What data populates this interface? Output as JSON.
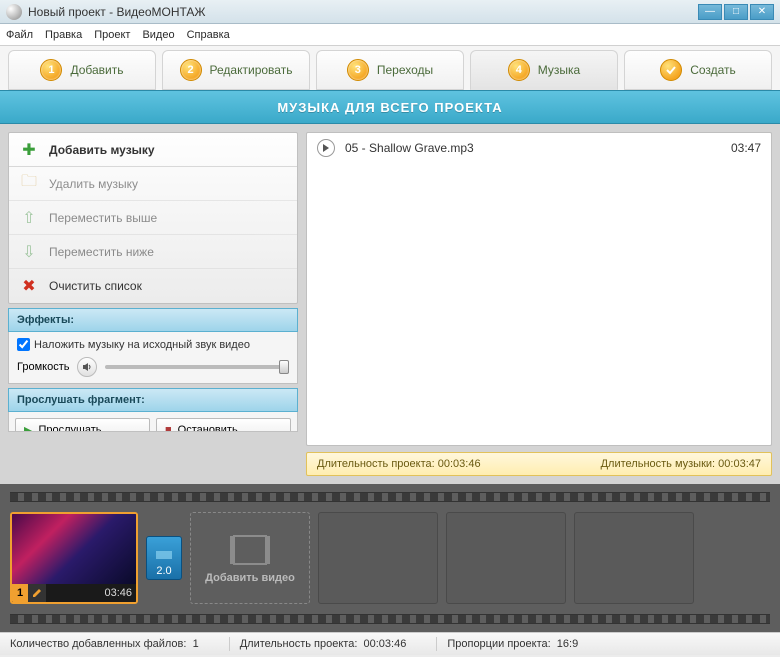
{
  "window": {
    "title": "Новый проект - ВидеоМОНТАЖ"
  },
  "menu": {
    "file": "Файл",
    "edit": "Правка",
    "project": "Проект",
    "video": "Видео",
    "help": "Справка"
  },
  "tabs": {
    "t1": {
      "num": "1",
      "label": "Добавить"
    },
    "t2": {
      "num": "2",
      "label": "Редактировать"
    },
    "t3": {
      "num": "3",
      "label": "Переходы"
    },
    "t4": {
      "num": "4",
      "label": "Музыка"
    },
    "t5": {
      "label": "Создать"
    }
  },
  "music_header": "МУЗЫКА ДЛЯ ВСЕГО ПРОЕКТА",
  "actions": {
    "add": "Добавить музыку",
    "delete": "Удалить музыку",
    "up": "Переместить выше",
    "down": "Переместить ниже",
    "clear": "Очистить список"
  },
  "effects": {
    "header": "Эффекты:",
    "overlay_label": "Наложить музыку на исходный звук видео",
    "volume_label": "Громкость"
  },
  "preview": {
    "header": "Прослушать фрагмент:",
    "play": "Прослушать",
    "stop": "Остановить"
  },
  "tracks": [
    {
      "name": "05 - Shallow Grave.mp3",
      "duration": "03:47"
    }
  ],
  "durations": {
    "project_label": "Длительность проекта:",
    "project_value": "00:03:46",
    "music_label": "Длительность музыки:",
    "music_value": "00:03:47"
  },
  "timeline": {
    "clip1": {
      "index": "1",
      "time": "03:46"
    },
    "transition": "2.0",
    "add_label": "Добавить видео"
  },
  "status": {
    "files_label": "Количество добавленных файлов:",
    "files_value": "1",
    "dur_label": "Длительность проекта:",
    "dur_value": "00:03:46",
    "ratio_label": "Пропорции проекта:",
    "ratio_value": "16:9"
  }
}
